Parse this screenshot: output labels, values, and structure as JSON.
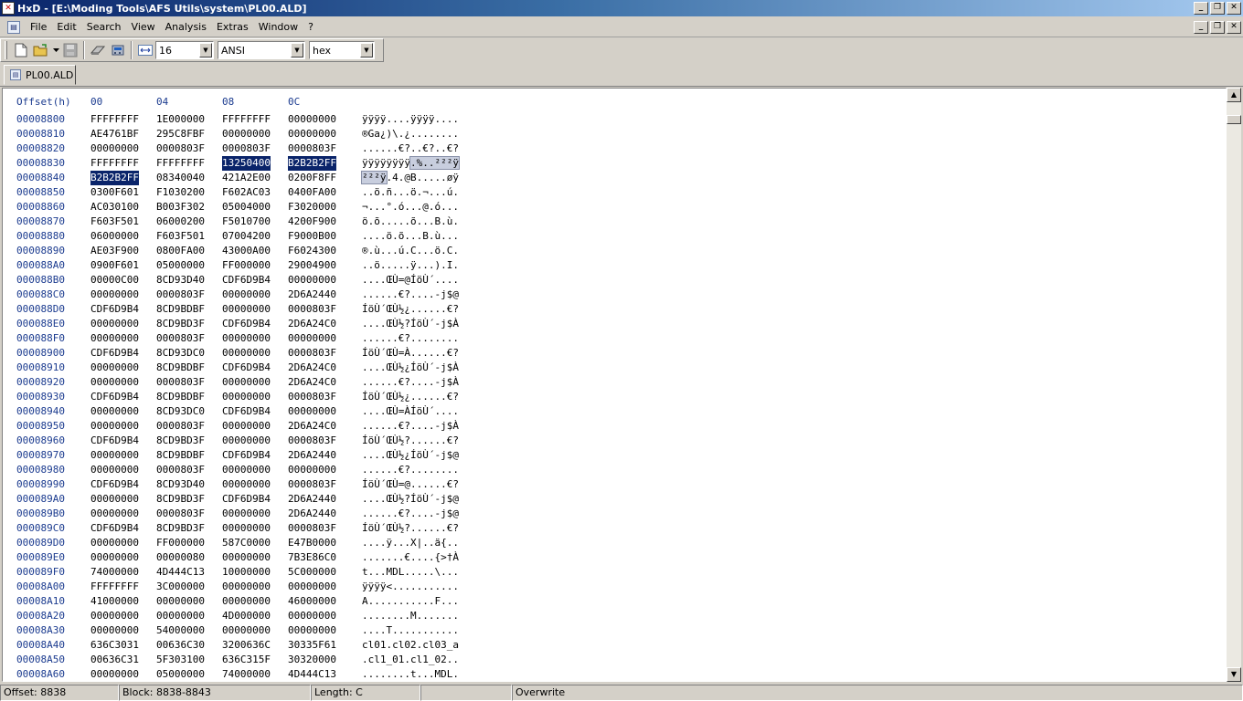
{
  "window": {
    "title": "HxD - [E:\\Moding Tools\\AFS Utils\\system\\PL00.ALD]",
    "minimize": "_",
    "maximize": "❐",
    "close": "✕"
  },
  "menu": {
    "items": [
      "File",
      "Edit",
      "Search",
      "View",
      "Analysis",
      "Extras",
      "Window",
      "?"
    ]
  },
  "toolbar": {
    "bytes_per_row": "16",
    "charset": "ANSI",
    "offset_base": "hex"
  },
  "tab": {
    "label": "PL00.ALD"
  },
  "editor": {
    "header": {
      "offset": "Offset(h)",
      "cols": [
        "00",
        "04",
        "08",
        "0C"
      ]
    },
    "rows": [
      {
        "off": "00008800",
        "g": [
          "FFFFFFFF",
          "1E000000",
          "FFFFFFFF",
          "00000000"
        ],
        "t": "ÿÿÿÿ....ÿÿÿÿ...."
      },
      {
        "off": "00008810",
        "g": [
          "AE4761BF",
          "295C8FBF",
          "00000000",
          "00000000"
        ],
        "t": "®Ga¿)\\.¿........"
      },
      {
        "off": "00008820",
        "g": [
          "00000000",
          "0000803F",
          "0000803F",
          "0000803F"
        ],
        "t": "......€?..€?..€?"
      },
      {
        "off": "00008830",
        "g": [
          "FFFFFFFF",
          "FFFFFFFF",
          "13250400",
          "B2B2B2FF"
        ],
        "t": "ÿÿÿÿÿÿÿÿ.%..²²²ÿ"
      },
      {
        "off": "00008840",
        "g": [
          "B2B2B2FF",
          "08340040",
          "421A2E00",
          "0200F8FF"
        ],
        "t": "²²²ÿ.4.@B.....øÿ"
      },
      {
        "off": "00008850",
        "g": [
          "0300F601",
          "F1030200",
          "F602AC03",
          "0400FA00"
        ],
        "t": "..ö.ñ...ö.¬...ú."
      },
      {
        "off": "00008860",
        "g": [
          "AC030100",
          "B003F302",
          "05004000",
          "F3020000"
        ],
        "t": "¬...°.ó...@.ó..."
      },
      {
        "off": "00008870",
        "g": [
          "F603F501",
          "06000200",
          "F5010700",
          "4200F900"
        ],
        "t": "ö.õ.....õ...B.ù."
      },
      {
        "off": "00008880",
        "g": [
          "06000000",
          "F603F501",
          "07004200",
          "F9000B00"
        ],
        "t": "....ö.õ...B.ù..."
      },
      {
        "off": "00008890",
        "g": [
          "AE03F900",
          "0800FA00",
          "43000A00",
          "F6024300"
        ],
        "t": "®.ù...ú.C...ö.C."
      },
      {
        "off": "000088A0",
        "g": [
          "0900F601",
          "05000000",
          "FF000000",
          "29004900"
        ],
        "t": "..ö.....ÿ...).I."
      },
      {
        "off": "000088B0",
        "g": [
          "00000C00",
          "8CD93D40",
          "CDF6D9B4",
          "00000000"
        ],
        "t": "....ŒÙ=@ÍöÙ´...."
      },
      {
        "off": "000088C0",
        "g": [
          "00000000",
          "0000803F",
          "00000000",
          "2D6A2440"
        ],
        "t": "......€?....-j$@"
      },
      {
        "off": "000088D0",
        "g": [
          "CDF6D9B4",
          "8CD9BDBF",
          "00000000",
          "0000803F"
        ],
        "t": "ÍöÙ´ŒÙ½¿......€?"
      },
      {
        "off": "000088E0",
        "g": [
          "00000000",
          "8CD9BD3F",
          "CDF6D9B4",
          "2D6A24C0"
        ],
        "t": "....ŒÙ½?ÍöÙ´-j$À"
      },
      {
        "off": "000088F0",
        "g": [
          "00000000",
          "0000803F",
          "00000000",
          "00000000"
        ],
        "t": "......€?........"
      },
      {
        "off": "00008900",
        "g": [
          "CDF6D9B4",
          "8CD93DC0",
          "00000000",
          "0000803F"
        ],
        "t": "ÍöÙ´ŒÙ=À......€?"
      },
      {
        "off": "00008910",
        "g": [
          "00000000",
          "8CD9BDBF",
          "CDF6D9B4",
          "2D6A24C0"
        ],
        "t": "....ŒÙ½¿ÍöÙ´-j$À"
      },
      {
        "off": "00008920",
        "g": [
          "00000000",
          "0000803F",
          "00000000",
          "2D6A24C0"
        ],
        "t": "......€?....-j$À"
      },
      {
        "off": "00008930",
        "g": [
          "CDF6D9B4",
          "8CD9BDBF",
          "00000000",
          "0000803F"
        ],
        "t": "ÍöÙ´ŒÙ½¿......€?"
      },
      {
        "off": "00008940",
        "g": [
          "00000000",
          "8CD93DC0",
          "CDF6D9B4",
          "00000000"
        ],
        "t": "....ŒÙ=ÀÍöÙ´...."
      },
      {
        "off": "00008950",
        "g": [
          "00000000",
          "0000803F",
          "00000000",
          "2D6A24C0"
        ],
        "t": "......€?....-j$À"
      },
      {
        "off": "00008960",
        "g": [
          "CDF6D9B4",
          "8CD9BD3F",
          "00000000",
          "0000803F"
        ],
        "t": "ÍöÙ´ŒÙ½?......€?"
      },
      {
        "off": "00008970",
        "g": [
          "00000000",
          "8CD9BDBF",
          "CDF6D9B4",
          "2D6A2440"
        ],
        "t": "....ŒÙ½¿ÍöÙ´-j$@"
      },
      {
        "off": "00008980",
        "g": [
          "00000000",
          "0000803F",
          "00000000",
          "00000000"
        ],
        "t": "......€?........"
      },
      {
        "off": "00008990",
        "g": [
          "CDF6D9B4",
          "8CD93D40",
          "00000000",
          "0000803F"
        ],
        "t": "ÍöÙ´ŒÙ=@......€?"
      },
      {
        "off": "000089A0",
        "g": [
          "00000000",
          "8CD9BD3F",
          "CDF6D9B4",
          "2D6A2440"
        ],
        "t": "....ŒÙ½?ÍöÙ´-j$@"
      },
      {
        "off": "000089B0",
        "g": [
          "00000000",
          "0000803F",
          "00000000",
          "2D6A2440"
        ],
        "t": "......€?....-j$@"
      },
      {
        "off": "000089C0",
        "g": [
          "CDF6D9B4",
          "8CD9BD3F",
          "00000000",
          "0000803F"
        ],
        "t": "ÍöÙ´ŒÙ½?......€?"
      },
      {
        "off": "000089D0",
        "g": [
          "00000000",
          "FF000000",
          "587C0000",
          "E47B0000"
        ],
        "t": "....ÿ...X|..ä{.."
      },
      {
        "off": "000089E0",
        "g": [
          "00000000",
          "00000080",
          "00000000",
          "7B3E86C0"
        ],
        "t": ".......€....{>†À"
      },
      {
        "off": "000089F0",
        "g": [
          "74000000",
          "4D444C13",
          "10000000",
          "5C000000"
        ],
        "t": "t...MDL.....\\..."
      },
      {
        "off": "00008A00",
        "g": [
          "FFFFFFFF",
          "3C000000",
          "00000000",
          "00000000"
        ],
        "t": "ÿÿÿÿ<..........."
      },
      {
        "off": "00008A10",
        "g": [
          "41000000",
          "00000000",
          "00000000",
          "46000000"
        ],
        "t": "A...........F..."
      },
      {
        "off": "00008A20",
        "g": [
          "00000000",
          "00000000",
          "4D000000",
          "00000000"
        ],
        "t": "........M......."
      },
      {
        "off": "00008A30",
        "g": [
          "00000000",
          "54000000",
          "00000000",
          "00000000"
        ],
        "t": "....T..........."
      },
      {
        "off": "00008A40",
        "g": [
          "636C3031",
          "00636C30",
          "3200636C",
          "30335F61"
        ],
        "t": "cl01.cl02.cl03_a"
      },
      {
        "off": "00008A50",
        "g": [
          "00636C31",
          "5F303100",
          "636C315F",
          "30320000"
        ],
        "t": ".cl1_01.cl1_02.."
      },
      {
        "off": "00008A60",
        "g": [
          "00000000",
          "05000000",
          "74000000",
          "4D444C13"
        ],
        "t": "........t...MDL."
      }
    ]
  },
  "status": {
    "offset": "Offset: 8838",
    "block": "Block: 8838-8843",
    "length": "Length: C",
    "empty": "",
    "mode": "Overwrite"
  },
  "colors": {
    "title_start": "#0a246a",
    "title_end": "#a6caf0",
    "offset_text": "#1b3b8f",
    "selection": "#0a246a"
  }
}
